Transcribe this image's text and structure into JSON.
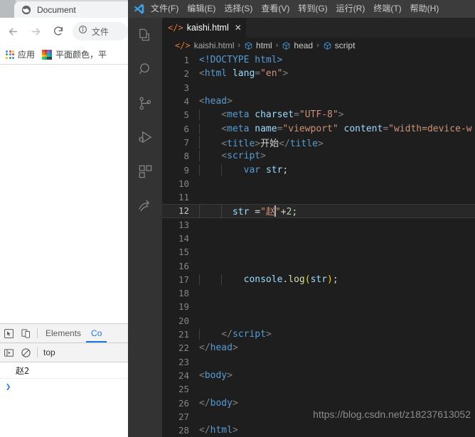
{
  "browser": {
    "tab": {
      "title": "Document",
      "favicon": "globe-icon"
    },
    "toolbar": {
      "back": "back-arrow-icon",
      "forward": "forward-arrow-icon",
      "reload": "reload-icon",
      "omnibox_icon": "info-circle-icon",
      "omnibox_value": "文件"
    },
    "bookmarks": [
      {
        "label": "应用",
        "icon": "apps-grid-icon"
      },
      {
        "label": "平面颜色，平",
        "icon": "color-swatch-icon"
      }
    ]
  },
  "devtools": {
    "inspect_icon": "inspect-cursor-icon",
    "device_icon": "device-toolbar-icon",
    "tabs": [
      {
        "label": "Elements",
        "active": false
      },
      {
        "label": "Co",
        "active": true
      }
    ],
    "filterbar": {
      "sidebar_icon": "console-sidebar-icon",
      "clear_icon": "clear-console-icon",
      "context": "top"
    },
    "console_output": [
      {
        "text": "赵2"
      }
    ],
    "prompt": "❯"
  },
  "vscode": {
    "logo": "vscode-logo-icon",
    "menus": [
      "文件(F)",
      "编辑(E)",
      "选择(S)",
      "查看(V)",
      "转到(G)",
      "运行(R)",
      "终端(T)",
      "帮助(H)"
    ],
    "activitybar": [
      "explorer-files-icon",
      "search-icon",
      "source-control-icon",
      "run-and-debug-icon",
      "extensions-icon",
      "remote-share-icon"
    ],
    "tab": {
      "icon": "</>",
      "name": "kaishi.html",
      "close": "✕"
    },
    "breadcrumb": {
      "file_icon": "</>",
      "file": "kaishi.html",
      "separator": "›",
      "items": [
        {
          "icon": "symbol-cube-icon",
          "label": "html"
        },
        {
          "icon": "symbol-cube-icon",
          "label": "head"
        },
        {
          "icon": "symbol-cube-icon",
          "label": "script"
        }
      ]
    },
    "active_line": 12,
    "lines": [
      {
        "n": "1",
        "indent": 0,
        "tokens": [
          {
            "t": "doctype",
            "v": "<!DOCTYPE "
          },
          {
            "t": "tag",
            "v": "html"
          },
          {
            "t": "doctype",
            "v": ">"
          }
        ]
      },
      {
        "n": "2",
        "indent": 0,
        "tokens": [
          {
            "t": "angle",
            "v": "<"
          },
          {
            "t": "tag",
            "v": "html"
          },
          {
            "t": "plain",
            "v": " "
          },
          {
            "t": "attr",
            "v": "lang"
          },
          {
            "t": "angle",
            "v": "="
          },
          {
            "t": "str",
            "v": "\"en\""
          },
          {
            "t": "angle",
            "v": ">"
          }
        ]
      },
      {
        "n": "3",
        "indent": 0,
        "tokens": []
      },
      {
        "n": "4",
        "indent": 0,
        "tokens": [
          {
            "t": "angle",
            "v": "<"
          },
          {
            "t": "tag",
            "v": "head"
          },
          {
            "t": "angle",
            "v": ">"
          }
        ]
      },
      {
        "n": "5",
        "indent": 1,
        "tokens": [
          {
            "t": "angle",
            "v": "    <"
          },
          {
            "t": "tag",
            "v": "meta"
          },
          {
            "t": "plain",
            "v": " "
          },
          {
            "t": "attr",
            "v": "charset"
          },
          {
            "t": "angle",
            "v": "="
          },
          {
            "t": "str",
            "v": "\"UTF-8\""
          },
          {
            "t": "angle",
            "v": ">"
          }
        ]
      },
      {
        "n": "6",
        "indent": 1,
        "tokens": [
          {
            "t": "angle",
            "v": "    <"
          },
          {
            "t": "tag",
            "v": "meta"
          },
          {
            "t": "plain",
            "v": " "
          },
          {
            "t": "attr",
            "v": "name"
          },
          {
            "t": "angle",
            "v": "="
          },
          {
            "t": "str",
            "v": "\"viewport\""
          },
          {
            "t": "plain",
            "v": " "
          },
          {
            "t": "attr",
            "v": "content"
          },
          {
            "t": "angle",
            "v": "="
          },
          {
            "t": "str",
            "v": "\"width=device-w"
          }
        ]
      },
      {
        "n": "7",
        "indent": 1,
        "tokens": [
          {
            "t": "angle",
            "v": "    <"
          },
          {
            "t": "tag",
            "v": "title"
          },
          {
            "t": "angle",
            "v": ">"
          },
          {
            "t": "text",
            "v": "开始"
          },
          {
            "t": "angle",
            "v": "</"
          },
          {
            "t": "tag",
            "v": "title"
          },
          {
            "t": "angle",
            "v": ">"
          }
        ]
      },
      {
        "n": "8",
        "indent": 1,
        "tokens": [
          {
            "t": "angle",
            "v": "    <"
          },
          {
            "t": "tag",
            "v": "script"
          },
          {
            "t": "angle",
            "v": ">"
          }
        ]
      },
      {
        "n": "9",
        "indent": 2,
        "tokens": [
          {
            "t": "plain",
            "v": "        "
          },
          {
            "t": "kw",
            "v": "var"
          },
          {
            "t": "plain",
            "v": " "
          },
          {
            "t": "var",
            "v": "str"
          },
          {
            "t": "punc",
            "v": ";"
          }
        ]
      },
      {
        "n": "10",
        "indent": 2,
        "tokens": []
      },
      {
        "n": "11",
        "indent": 2,
        "tokens": []
      },
      {
        "n": "12",
        "indent": 2,
        "tokens": [
          {
            "t": "plain",
            "v": "      "
          },
          {
            "t": "var",
            "v": "str"
          },
          {
            "t": "plain",
            "v": " ="
          },
          {
            "t": "str",
            "v": "\"赵"
          },
          {
            "t": "cursor",
            "v": ""
          },
          {
            "t": "str",
            "v": "\""
          },
          {
            "t": "plain",
            "v": "+"
          },
          {
            "t": "num",
            "v": "2"
          },
          {
            "t": "punc",
            "v": ";"
          }
        ]
      },
      {
        "n": "13",
        "indent": 2,
        "tokens": []
      },
      {
        "n": "14",
        "indent": 2,
        "tokens": []
      },
      {
        "n": "15",
        "indent": 2,
        "tokens": []
      },
      {
        "n": "16",
        "indent": 2,
        "tokens": []
      },
      {
        "n": "17",
        "indent": 2,
        "tokens": [
          {
            "t": "plain",
            "v": "        "
          },
          {
            "t": "var",
            "v": "console"
          },
          {
            "t": "punc",
            "v": "."
          },
          {
            "t": "fn",
            "v": "log"
          },
          {
            "t": "paren",
            "v": "("
          },
          {
            "t": "var",
            "v": "str"
          },
          {
            "t": "paren",
            "v": ")"
          },
          {
            "t": "punc",
            "v": ";"
          }
        ]
      },
      {
        "n": "18",
        "indent": 2,
        "tokens": []
      },
      {
        "n": "19",
        "indent": 2,
        "tokens": []
      },
      {
        "n": "20",
        "indent": 2,
        "tokens": []
      },
      {
        "n": "21",
        "indent": 1,
        "tokens": [
          {
            "t": "angle",
            "v": "    </"
          },
          {
            "t": "tag",
            "v": "script"
          },
          {
            "t": "angle",
            "v": ">"
          }
        ]
      },
      {
        "n": "22",
        "indent": 0,
        "tokens": [
          {
            "t": "angle",
            "v": "</"
          },
          {
            "t": "tag",
            "v": "head"
          },
          {
            "t": "angle",
            "v": ">"
          }
        ]
      },
      {
        "n": "23",
        "indent": 0,
        "tokens": []
      },
      {
        "n": "24",
        "indent": 0,
        "tokens": [
          {
            "t": "angle",
            "v": "<"
          },
          {
            "t": "tag",
            "v": "body"
          },
          {
            "t": "angle",
            "v": ">"
          }
        ]
      },
      {
        "n": "25",
        "indent": 0,
        "tokens": []
      },
      {
        "n": "26",
        "indent": 0,
        "tokens": [
          {
            "t": "angle",
            "v": "</"
          },
          {
            "t": "tag",
            "v": "body"
          },
          {
            "t": "angle",
            "v": ">"
          }
        ]
      },
      {
        "n": "27",
        "indent": 0,
        "tokens": []
      },
      {
        "n": "28",
        "indent": 0,
        "tokens": [
          {
            "t": "angle",
            "v": "</"
          },
          {
            "t": "tag",
            "v": "html"
          },
          {
            "t": "angle",
            "v": ">"
          }
        ]
      }
    ]
  },
  "watermark": "https://blog.csdn.net/z18237613052",
  "colors": {
    "editor_bg": "#1e1e1e",
    "sidebar_bg": "#333333",
    "menubar_bg": "#3c3c3c",
    "tabbar_bg": "#252526",
    "accent_blue": "#1a73e8",
    "devtools_bg": "#f3f3f3"
  }
}
